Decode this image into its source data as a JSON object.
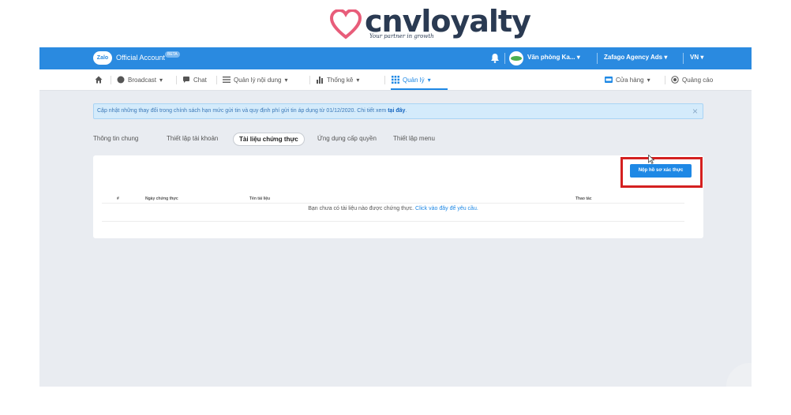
{
  "brand": {
    "name": "cnvloyalty",
    "tagline": "Your partner in growth",
    "heart_color": "#e85d7a"
  },
  "topbar": {
    "logo_text": "Zalo",
    "title": "Official Account",
    "badge": "BETA",
    "account": "Văn phòng Ka...",
    "agency": "Zafago Agency Ads",
    "language": "VN",
    "color": "#2a8ae0"
  },
  "nav": {
    "home_icon": "home-icon",
    "broadcast": "Broadcast",
    "chat": "Chat",
    "content": "Quản lý nội dung",
    "stats": "Thống kê",
    "manage": "Quản lý",
    "store": "Cửa hàng",
    "ads": "Quảng cáo"
  },
  "notice": {
    "text": "Cập nhật những thay đổi trong chính sách hạn mức gửi tin và quy định phí gửi tin áp dụng từ 01/12/2020. Chi tiết xem ",
    "link": "tại đây",
    "suffix": "."
  },
  "tabs": {
    "general": "Thông tin chung",
    "account_setup": "Thiết lập tài khoản",
    "documents": "Tài liệu chứng thực",
    "apps": "Ứng dụng cấp quyền",
    "menu": "Thiết lập menu"
  },
  "actions": {
    "submit": "Nộp hồ sơ xác thực"
  },
  "table": {
    "columns": [
      "#",
      "Ngày chứng thực",
      "Tên tài liệu",
      "Thao tác"
    ],
    "empty_text": "Bạn chưa có tài liệu nào được chứng thực. ",
    "empty_link": "Click vào đây để yêu cầu."
  }
}
